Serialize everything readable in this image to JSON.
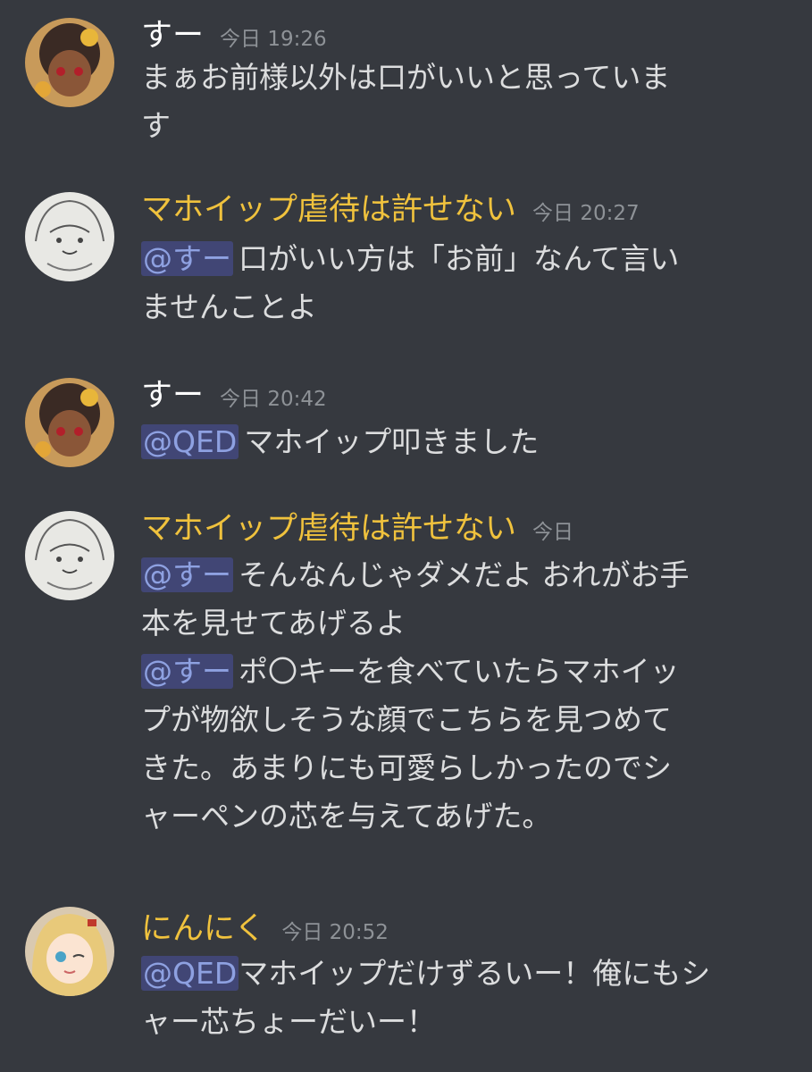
{
  "colors": {
    "background": "#36393f",
    "username_default": "#ffffff",
    "username_highlight": "#f0c23d",
    "mention_bg": "#414675",
    "mention_text": "#8ea1e1",
    "timestamp": "#8e9297",
    "body_text": "#dcddde"
  },
  "messages": [
    {
      "username": "すー",
      "timestamp": "今日 19:26",
      "lines": [
        {
          "text": "まぁお前様以外は口がいいと思っていま"
        },
        {
          "text": "す"
        }
      ]
    },
    {
      "username": "マホイップ虐待は許せない",
      "timestamp": "今日 20:27",
      "lines": [
        {
          "mention": "@すー",
          "text": "口がいい方は「お前」なんて言い"
        },
        {
          "text": "ませんことよ"
        }
      ]
    },
    {
      "username": "すー",
      "timestamp": "今日 20:42",
      "lines": [
        {
          "mention": "@QED",
          "text": "マホイップ叩きました"
        }
      ]
    },
    {
      "username": "マホイップ虐待は許せない",
      "timestamp": "今日",
      "lines": [
        {
          "mention": "@すー",
          "text": "そんなんじゃダメだよ おれがお手"
        },
        {
          "text": "本を見せてあげるよ"
        },
        {
          "mention": "@すー",
          "text": "ポ〇キーを食べていたらマホイッ"
        },
        {
          "text": "プが物欲しそうな顔でこちらを見つめて"
        },
        {
          "text": "きた。あまりにも可愛らしかったのでシ"
        },
        {
          "text": "ャーペンの芯を与えてあげた。"
        }
      ]
    },
    {
      "username": "にんにく",
      "timestamp": "今日 20:52",
      "lines": [
        {
          "mention": "@QED",
          "text": "マホイップだけずるいー！俺にもシ"
        },
        {
          "text": "ャー芯ちょーだいー！"
        }
      ]
    }
  ]
}
